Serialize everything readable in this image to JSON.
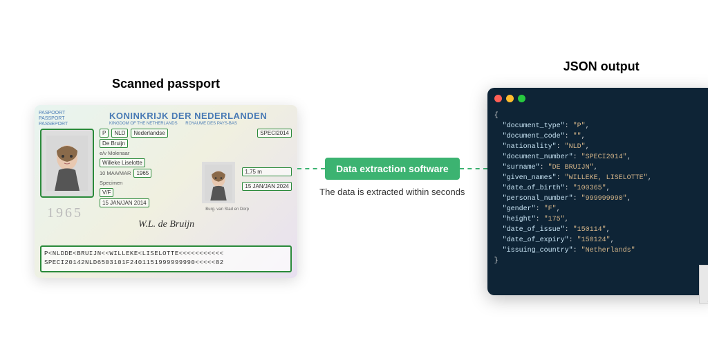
{
  "left": {
    "title": "Scanned passport",
    "sidelabel_1": "PASPOORT",
    "sidelabel_2": "PASSPORT",
    "sidelabel_3": "PASSEPORT",
    "header": "KONINKRIJK DER NEDERLANDEN",
    "subheader_1": "KINGDOM OF THE NETHERLANDS",
    "subheader_2": "ROYAUME DES PAYS-BAS",
    "fields": {
      "code_p": "P",
      "code_nld": "NLD",
      "nationality": "Nederlandse",
      "doc_number": "SPECI2014",
      "surname": "De Bruijn",
      "surname_note": "e/v Molenaar",
      "given": "Willeke Liselotte",
      "dob_label": "10 MAA/MAR",
      "dob_year": "1965",
      "place": "Specimen",
      "sex": "V/F",
      "issue_date": "15 JAN/JAN 2014",
      "height": "1,75 m",
      "expiry_date": "15 JAN/JAN 2024"
    },
    "burg": "Burg. van Stad en Dorp",
    "signature": "W.L. de Bruijn",
    "year_watermark": "1965",
    "mrz_line1": "P<NLDDE<BRUIJN<<WILLEKE<LISELOTTE<<<<<<<<<<<",
    "mrz_line2": "SPECI20142NLD6503101F2401151999999990<<<<<82"
  },
  "middle": {
    "badge": "Data extraction software",
    "subtext": "The data is extracted within seconds"
  },
  "right": {
    "title": "JSON output",
    "json": [
      {
        "k": "document_type",
        "v": "P"
      },
      {
        "k": "document_code",
        "v": ""
      },
      {
        "k": "nationality",
        "v": "NLD"
      },
      {
        "k": "document_number",
        "v": "SPECI2014"
      },
      {
        "k": "surname",
        "v": "DE BRUIJN"
      },
      {
        "k": "given_names",
        "v": "WILLEKE, LISELOTTE"
      },
      {
        "k": "date_of_birth",
        "v": "100365"
      },
      {
        "k": "personal_number",
        "v": "999999990"
      },
      {
        "k": "gender",
        "v": "F"
      },
      {
        "k": "height",
        "v": "175"
      },
      {
        "k": "date_of_issue",
        "v": "150114"
      },
      {
        "k": "date_of_expiry",
        "v": "150124"
      },
      {
        "k": "issuing_country",
        "v": "Netherlands"
      }
    ]
  }
}
